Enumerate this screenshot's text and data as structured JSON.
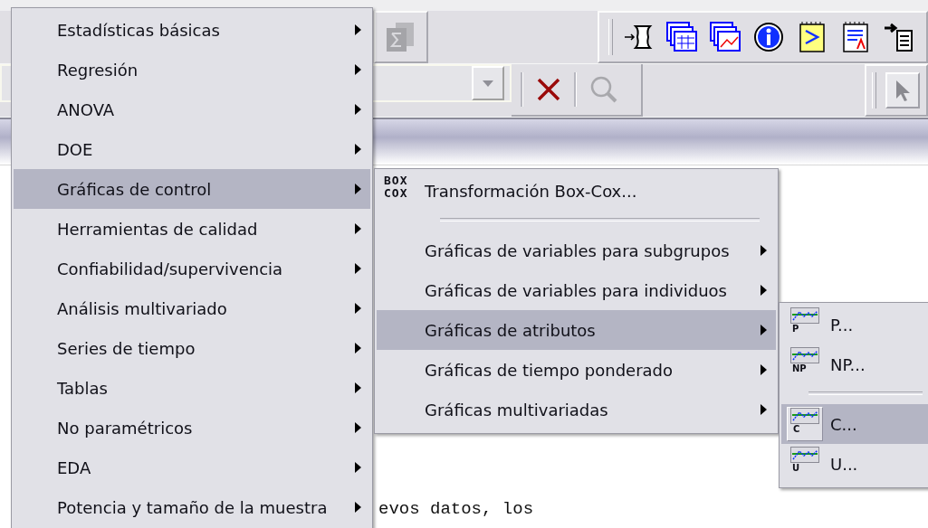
{
  "menu": {
    "items": [
      {
        "label": "Estadísticas básicas",
        "selected": false,
        "submenu": true
      },
      {
        "label": "Regresión",
        "selected": false,
        "submenu": true
      },
      {
        "label": "ANOVA",
        "selected": false,
        "submenu": true
      },
      {
        "label": "DOE",
        "selected": false,
        "submenu": true
      },
      {
        "label": "Gráficas de control",
        "selected": true,
        "submenu": true
      },
      {
        "label": "Herramientas de calidad",
        "selected": false,
        "submenu": true
      },
      {
        "label": "Confiabilidad/supervivencia",
        "selected": false,
        "submenu": true
      },
      {
        "label": "Análisis multivariado",
        "selected": false,
        "submenu": true
      },
      {
        "label": "Series de tiempo",
        "selected": false,
        "submenu": true
      },
      {
        "label": "Tablas",
        "selected": false,
        "submenu": true
      },
      {
        "label": "No paramétricos",
        "selected": false,
        "submenu": true
      },
      {
        "label": "EDA",
        "selected": false,
        "submenu": true
      },
      {
        "label": "Potencia y tamaño de la muestra",
        "selected": false,
        "submenu": true
      }
    ]
  },
  "control_charts_menu": {
    "items": [
      {
        "kind": "command",
        "label": "Transformación Box-Cox...",
        "icon_text": [
          "BOX",
          "COX"
        ],
        "selected": false,
        "submenu": false
      },
      {
        "kind": "separator"
      },
      {
        "kind": "command",
        "label": "Gráficas de variables para subgrupos",
        "selected": false,
        "submenu": true
      },
      {
        "kind": "command",
        "label": "Gráficas de variables para individuos",
        "selected": false,
        "submenu": true
      },
      {
        "kind": "command",
        "label": "Gráficas de atributos",
        "selected": true,
        "submenu": true
      },
      {
        "kind": "command",
        "label": "Gráficas de tiempo ponderado",
        "selected": false,
        "submenu": true
      },
      {
        "kind": "command",
        "label": "Gráficas multivariadas",
        "selected": false,
        "submenu": true
      }
    ]
  },
  "attributes_menu": {
    "items": [
      {
        "kind": "command",
        "label": "P...",
        "icon_text": "P",
        "selected": false
      },
      {
        "kind": "command",
        "label": "NP...",
        "icon_text": "NP",
        "selected": false
      },
      {
        "kind": "separator"
      },
      {
        "kind": "command",
        "label": "C...",
        "icon_text": "C",
        "selected": true
      },
      {
        "kind": "command",
        "label": "U...",
        "icon_text": "U",
        "selected": false
      }
    ]
  },
  "session": {
    "text": "evos datos, los"
  }
}
